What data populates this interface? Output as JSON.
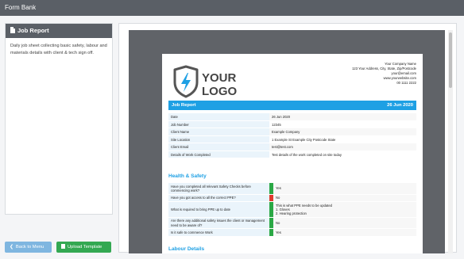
{
  "app_title": "Form Bank",
  "sidebar": {
    "header": "Job Report",
    "description": "Daily job sheet collecting basic safety, labour and materials details with client & tech sign off."
  },
  "buttons": {
    "back_label": "Back to Menu",
    "upload_label": "Upload Template"
  },
  "document": {
    "logo_line1": "YOUR",
    "logo_line2": "LOGO",
    "company": {
      "name": "Your Company Name",
      "address": "123 Your Address, City, State, Zip/Postcode",
      "email": "your@email.com",
      "website": "www.yourwebsite.com",
      "phone": "00 1111 2222"
    },
    "title": "Job Report",
    "title_date": "26 Jun 2020",
    "details": [
      {
        "label": "Date",
        "value": "26 Jun 2020"
      },
      {
        "label": "Job Number",
        "value": "12345"
      },
      {
        "label": "Client Name",
        "value": "Example Company"
      },
      {
        "label": "Site Location",
        "value": "1 Example St Example City Postcode State"
      },
      {
        "label": "Client Email",
        "value": "test@test.com"
      },
      {
        "label": "Details of Work Completed",
        "value": "Test details of the work completed on site today"
      }
    ],
    "health_safety_heading": "Health & Safety",
    "safety": [
      {
        "q": "Have you completed all relevant Safety Checks before commencing work?",
        "a": "Yes",
        "status": "green"
      },
      {
        "q": "Have you got access to all the correct PPE?",
        "a": "No",
        "status": "red"
      },
      {
        "q": "What is required to bring PPE up to date",
        "a1": "This is what PPE needs to be updated",
        "a2": "1. Gloves",
        "a3": "2. Hearing protection",
        "status": "green"
      },
      {
        "q": "Are there any additional safety issues the client or management need to be aware of?",
        "a": "No",
        "status": "green"
      },
      {
        "q": "Is it safe to commence Work",
        "a": "Yes",
        "status": "green"
      }
    ],
    "labour_heading": "Labour Details"
  },
  "colors": {
    "accent": "#1ea0e4",
    "topbar": "#5a5f66",
    "yes": "#2ba845",
    "no": "#e03a2e"
  }
}
